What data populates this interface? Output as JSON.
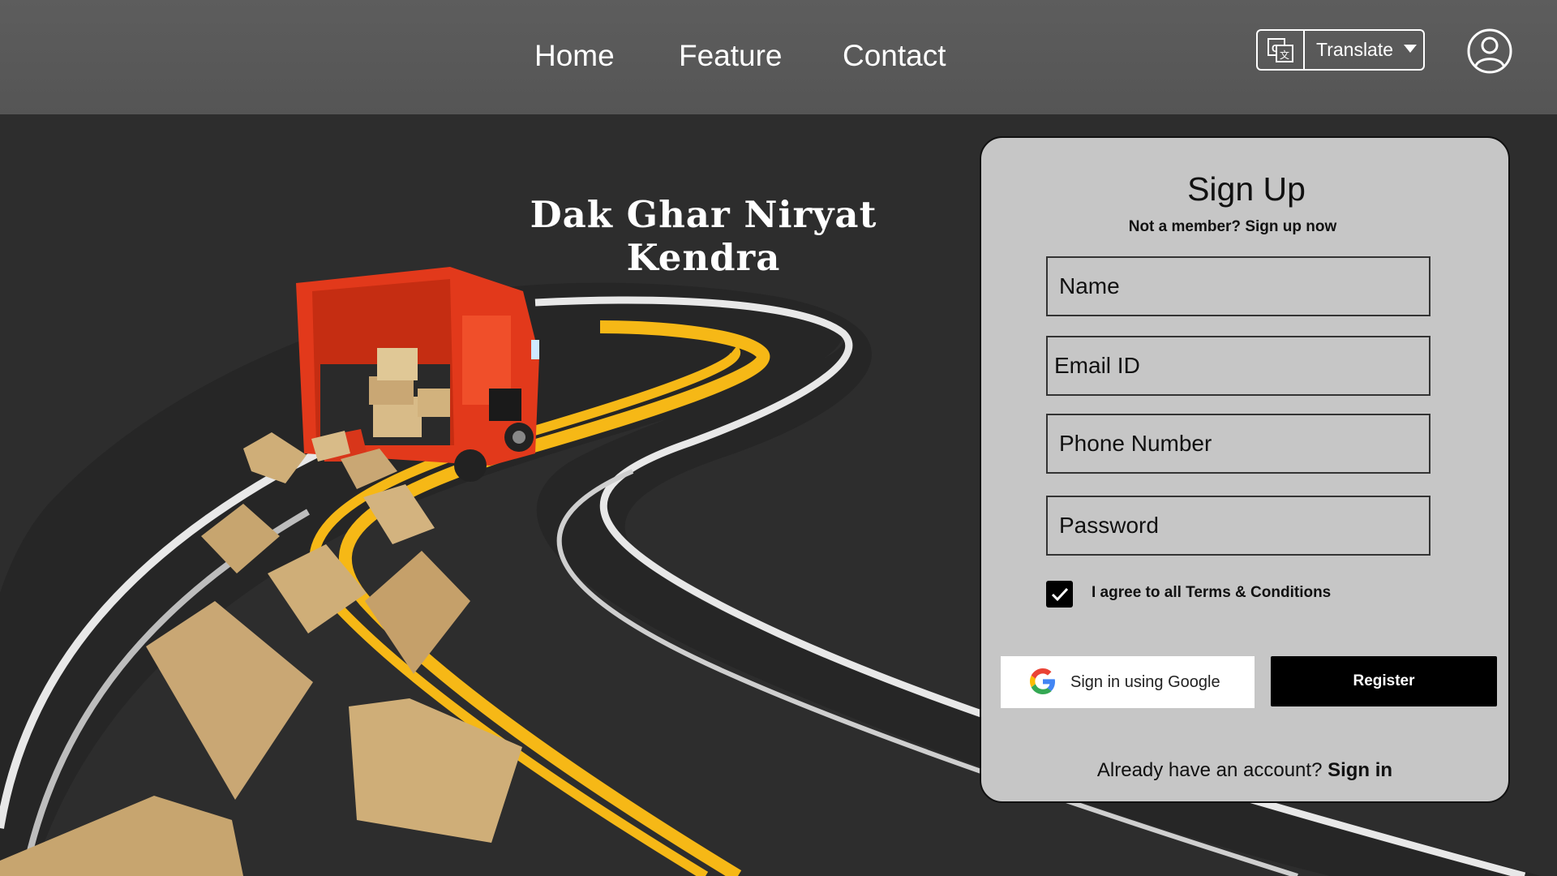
{
  "nav": {
    "links": [
      "Home",
      "Feature",
      "Contact"
    ],
    "translate_label": "Translate",
    "translate_icon": "translate-icon",
    "profile_icon": "user-circle-icon"
  },
  "hero": {
    "title": "Dak Ghar Niryat Kendra"
  },
  "signup": {
    "title": "Sign Up",
    "subtitle": "Not a member? Sign up now",
    "fields": {
      "name_placeholder": "Name",
      "email_placeholder": "Email ID",
      "phone_placeholder": "Phone Number",
      "password_placeholder": "Password"
    },
    "agree_checked": true,
    "agree_label": "I agree to all Terms & Conditions",
    "google_label": "Sign in using Google",
    "register_label": "Register",
    "already_text": "Already have an account?",
    "signin_label": "Sign in"
  },
  "colors": {
    "header_bg": "#585858",
    "page_bg": "#2d2d2d",
    "card_bg": "#c6c6c6",
    "road_yellow": "#f6b816",
    "van_red": "#e2391b",
    "box_tan": "#c9a774"
  }
}
